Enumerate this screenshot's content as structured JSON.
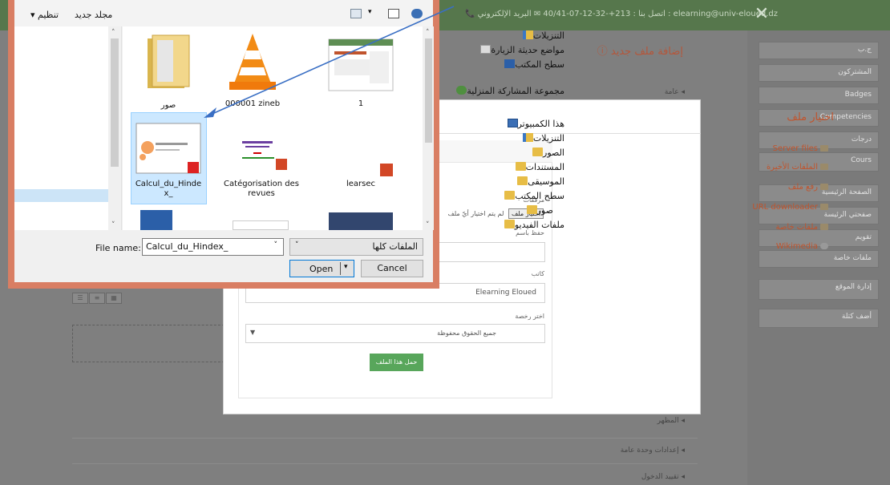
{
  "topbar": {
    "contact": "📞 اتصل بنا : 213+-32-12-07-40/41 ✉ البريد الإلكتروني : elearning@univ-eloued.dz",
    "close_glyph": "✕"
  },
  "sidebar": {
    "items": [
      {
        "label": "ج.ب"
      },
      {
        "label": "المشتركون"
      },
      {
        "label": "Badges"
      },
      {
        "label": "Competencies"
      },
      {
        "label": "درجات"
      },
      {
        "label": "Cours"
      },
      {
        "label": "الصفحة الرئيسية"
      },
      {
        "label": "صفحتي الرئيسة"
      },
      {
        "label": "تقويم"
      },
      {
        "label": "ملفات خاصة"
      },
      {
        "label": "إدارة الموقع"
      },
      {
        "label": "أضف كتلة"
      }
    ]
  },
  "page": {
    "title": "إضافة ملف جديد ⓘ",
    "general": "◂ عامة",
    "sections": [
      "◂ المظهر",
      "◂ إعدادات وحدة عامة",
      "◂ تقييد الدخول"
    ]
  },
  "picker": {
    "title": "اختيار ملف",
    "repositories": [
      {
        "label": "Server files",
        "en": true
      },
      {
        "label": "الملفات الأخيرة",
        "en": false
      },
      {
        "label": "رفع ملف",
        "en": false
      },
      {
        "label": "URL downloader",
        "en": true
      },
      {
        "label": "ملفات خاصة",
        "en": false
      },
      {
        "label": "Wikimedia",
        "en": true
      }
    ],
    "attachment_label": "مرفقات",
    "choose_button": "اختيار ملف",
    "choose_status": "لم يتم اختيار أيّ ملف",
    "save_as_label": "حفظ باسم",
    "save_as_value": "",
    "author_label": "كاتب",
    "author_value": "Elearning Eloued",
    "license_label": "اختر رخصة",
    "license_value": "جميع الحقوق محفوظة",
    "upload_button": "حمل هذا الملف"
  },
  "dialog": {
    "toolbar": {
      "organize": "تنظيم",
      "new_folder": "مجلد جديد"
    },
    "nav": [
      {
        "label": "التنزيلات",
        "icon": "downloads-folder-icon",
        "cls": "ico-dl"
      },
      {
        "label": "مواضع حديثة الزيارة",
        "icon": "recent-places-icon",
        "cls": "ico-doc"
      },
      {
        "label": "سطح المكتب",
        "icon": "desktop-icon",
        "cls": "ico-blue"
      },
      {
        "label": "مجموعة المشاركة المنزلية",
        "icon": "homegroup-icon",
        "cls": "ico-net"
      },
      {
        "label": "هذا الكمبيوتر",
        "icon": "computer-icon",
        "cls": "ico-pc"
      },
      {
        "label": "التنزيلات",
        "icon": "downloads-folder-icon",
        "cls": "ico-dl"
      },
      {
        "label": "الصور",
        "icon": "pictures-folder-icon",
        "cls": "ico-folder"
      },
      {
        "label": "المستندات",
        "icon": "documents-folder-icon",
        "cls": "ico-folder"
      },
      {
        "label": "الموسيقى",
        "icon": "music-folder-icon",
        "cls": "ico-folder"
      },
      {
        "label": "سطح المكتب",
        "icon": "desktop-folder-icon",
        "cls": "ico-folder"
      },
      {
        "label": "صور",
        "icon": "folder-icon",
        "cls": "ico-folder"
      },
      {
        "label": "ملفات الفيديو",
        "icon": "videos-folder-icon",
        "cls": "ico-folder"
      }
    ],
    "files": [
      {
        "label": "صور",
        "icon": "folder-icon"
      },
      {
        "label": "000001 zineb",
        "icon": "vlc-icon"
      },
      {
        "label": "1",
        "icon": "image-thumbnail-icon"
      },
      {
        "label": "Calcul_du_Hinde x_",
        "icon": "pdf-file-icon"
      },
      {
        "label": "Catégorisation des revues",
        "icon": "powerpoint-file-icon"
      },
      {
        "label": "learsec",
        "icon": "powerpoint-file-icon"
      }
    ],
    "file_name_label": "File name:",
    "file_name_value": "Calcul_du_Hindex_",
    "file_type_value": "الملفات كلها",
    "open_button": "Open",
    "cancel_button": "Cancel"
  },
  "colors": {
    "accent_orange": "#c0542d",
    "topbar_green": "#56774c",
    "upload_green": "#58a65b",
    "dialog_frame": "#d97e63",
    "selection_blue": "#cce8ff"
  }
}
